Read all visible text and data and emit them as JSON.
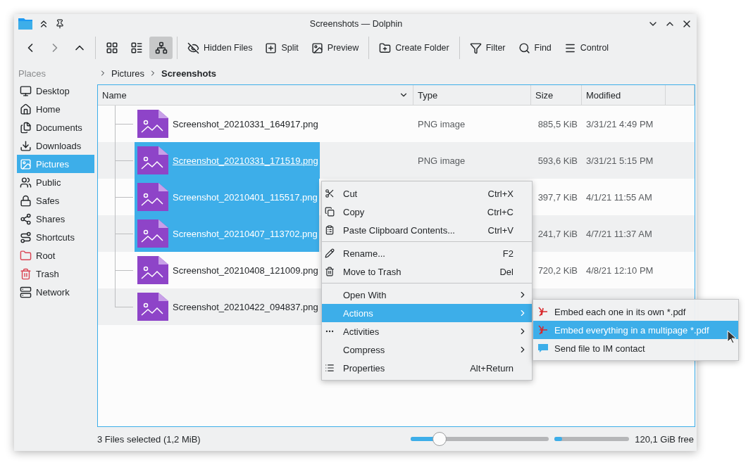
{
  "window": {
    "title": "Screenshots — Dolphin"
  },
  "view_modes": [
    {
      "selected": false
    },
    {
      "selected": false
    },
    {
      "selected": true
    }
  ],
  "toolbar_actions": [
    {
      "label": "Hidden Files"
    },
    {
      "label": "Split"
    },
    {
      "label": "Preview"
    },
    {
      "label": "Create Folder"
    },
    {
      "label": "Filter"
    },
    {
      "label": "Find"
    },
    {
      "label": "Control"
    }
  ],
  "places": {
    "title": "Places",
    "items": [
      {
        "label": "Desktop",
        "selected": false
      },
      {
        "label": "Home",
        "selected": false
      },
      {
        "label": "Documents",
        "selected": false
      },
      {
        "label": "Downloads",
        "selected": false
      },
      {
        "label": "Pictures",
        "selected": true
      },
      {
        "label": "Public",
        "selected": false
      },
      {
        "label": "Safes",
        "selected": false
      },
      {
        "label": "Shares",
        "selected": false
      },
      {
        "label": "Shortcuts",
        "selected": false
      },
      {
        "label": "Root",
        "selected": false
      },
      {
        "label": "Trash",
        "selected": false
      },
      {
        "label": "Network",
        "selected": false
      }
    ]
  },
  "breadcrumb": [
    "Pictures",
    "Screenshots"
  ],
  "table": {
    "columns": [
      "Name",
      "Type",
      "Size",
      "Modified"
    ],
    "rows": [
      {
        "name": "Screenshot_20210331_164917.png",
        "type": "PNG image",
        "size": "885,5 KiB",
        "modified": "3/31/21 4:49 PM",
        "selected": false,
        "hovered": false
      },
      {
        "name": "Screenshot_20210331_171519.png",
        "type": "PNG image",
        "size": "593,6 KiB",
        "modified": "3/31/21 5:15 PM",
        "selected": true,
        "hovered": true
      },
      {
        "name": "Screenshot_20210401_115517.png",
        "size": "397,7 KiB",
        "modified": "4/1/21 11:55 AM",
        "selected": true,
        "hovered": false
      },
      {
        "name": "Screenshot_20210407_113702.png",
        "size": "241,7 KiB",
        "modified": "4/7/21 11:37 AM",
        "selected": true,
        "hovered": false
      },
      {
        "name": "Screenshot_20210408_121009.png",
        "size": "720,2 KiB",
        "modified": "4/8/21 12:10 PM",
        "selected": false,
        "hovered": false
      },
      {
        "name": "Screenshot_20210422_094837.png",
        "selected": false,
        "hovered": false
      }
    ]
  },
  "context_menu": {
    "groups": [
      [
        {
          "label": "Cut",
          "shortcut": "Ctrl+X",
          "submenu": false,
          "selected": false
        },
        {
          "label": "Copy",
          "shortcut": "Ctrl+C",
          "submenu": false,
          "selected": false
        },
        {
          "label": "Paste Clipboard Contents...",
          "shortcut": "Ctrl+V",
          "submenu": false,
          "selected": false
        }
      ],
      [
        {
          "label": "Rename...",
          "shortcut": "F2",
          "submenu": false,
          "selected": false
        },
        {
          "label": "Move to Trash",
          "shortcut": "Del",
          "submenu": false,
          "selected": false
        }
      ],
      [
        {
          "label": "Open With",
          "submenu": true,
          "selected": false
        },
        {
          "label": "Actions",
          "submenu": true,
          "selected": true
        },
        {
          "label": "Activities",
          "submenu": true,
          "selected": false
        },
        {
          "label": "Compress",
          "submenu": true,
          "selected": false
        },
        {
          "label": "Properties",
          "shortcut": "Alt+Return",
          "submenu": false,
          "selected": false
        }
      ]
    ]
  },
  "submenu": {
    "items": [
      {
        "label": "Embed each one in its own *.pdf",
        "kind": "pdf",
        "selected": false
      },
      {
        "label": "Embed everything in a multipage *.pdf",
        "kind": "pdf",
        "selected": true
      },
      {
        "label": "Send file to IM contact",
        "kind": "chat",
        "selected": false
      }
    ]
  },
  "status_bar": {
    "text": "3 Files selected (1,2 MiB)",
    "zoom": {
      "level": 0.21
    },
    "disk": {
      "level": 0.1
    },
    "free": "120,1 GiB free"
  }
}
